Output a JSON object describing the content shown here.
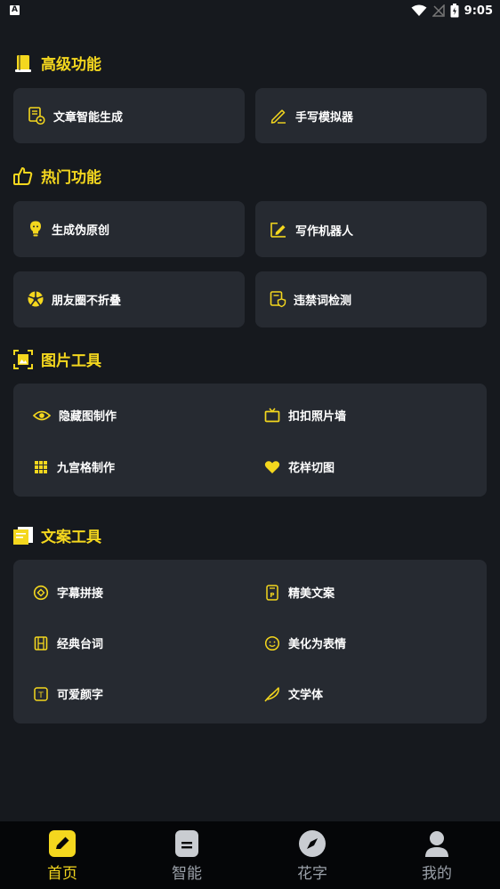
{
  "status_bar": {
    "time": "9:05",
    "notification_letter": "A"
  },
  "sections": {
    "advanced": {
      "title": "高级功能",
      "items": [
        "文章智能生成",
        "手写模拟器"
      ]
    },
    "hot": {
      "title": "热门功能",
      "items": [
        "生成伪原创",
        "写作机器人",
        "朋友圈不折叠",
        "违禁词检测"
      ]
    },
    "image_tools": {
      "title": "图片工具",
      "items": [
        "隐藏图制作",
        "扣扣照片墙",
        "九宫格制作",
        "花样切图"
      ]
    },
    "copy_tools": {
      "title": "文案工具",
      "items": [
        "字幕拼接",
        "精美文案",
        "经典台词",
        "美化为表情",
        "可爱颜字",
        "文学体"
      ]
    }
  },
  "bottom_nav": {
    "items": [
      "首页",
      "智能",
      "花字",
      "我的"
    ],
    "active": "首页"
  },
  "colors": {
    "accent": "#f4d71e",
    "background": "#16191e",
    "card": "#262a31",
    "nav_background": "#050608"
  }
}
